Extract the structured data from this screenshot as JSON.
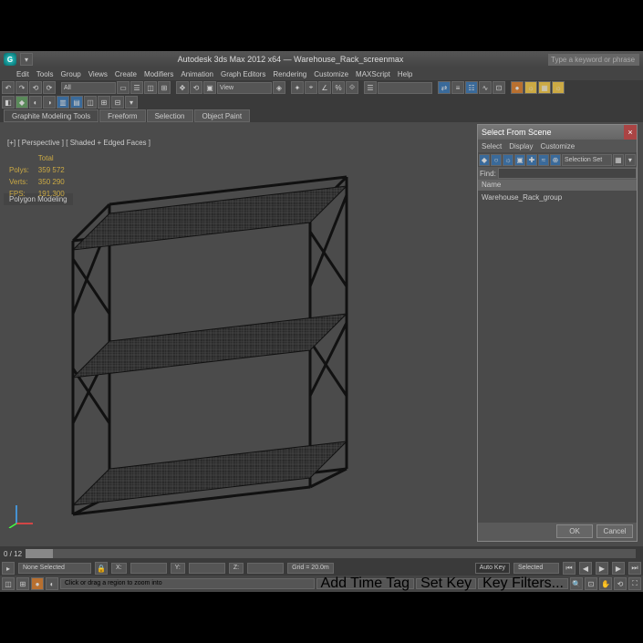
{
  "title": "Autodesk 3ds Max 2012 x64 — Warehouse_Rack_screenmax",
  "search_placeholder": "Type a keyword or phrase",
  "menu": [
    "Edit",
    "Tools",
    "Group",
    "Views",
    "Create",
    "Modifiers",
    "Animation",
    "Graph Editors",
    "Rendering",
    "Customize",
    "MAXScript",
    "Help"
  ],
  "tabs": [
    "Graphite Modeling Tools",
    "Freeform",
    "Selection",
    "Object Paint"
  ],
  "subtab": "Polygon Modeling",
  "viewport_label": "[+] [ Perspective ] [ Shaded + Edged Faces ]",
  "stats": {
    "rows": [
      [
        "",
        "Total"
      ],
      [
        "Polys:",
        "359 572"
      ],
      [
        "Verts:",
        "350 290"
      ],
      [
        "FPS:",
        "191.300"
      ]
    ]
  },
  "dialog": {
    "title": "Select From Scene",
    "menu": [
      "Select",
      "Display",
      "Customize"
    ],
    "find_label": "Find:",
    "selset": "Selection Set",
    "name_hdr": "Name",
    "items": [
      "Warehouse_Rack_group"
    ],
    "ok": "OK",
    "cancel": "Cancel"
  },
  "timeline": {
    "frame": "0 / 12"
  },
  "status": {
    "none": "None Selected",
    "hint": "Click or drag a region to zoom into",
    "x": "X:",
    "y": "Y:",
    "z": "Z:",
    "grid": "Grid = 20.0m",
    "addtag": "Add Time Tag",
    "autokey": "Auto Key",
    "setkey": "Set Key",
    "keyfilters": "Key Filters...",
    "selected": "Selected"
  }
}
